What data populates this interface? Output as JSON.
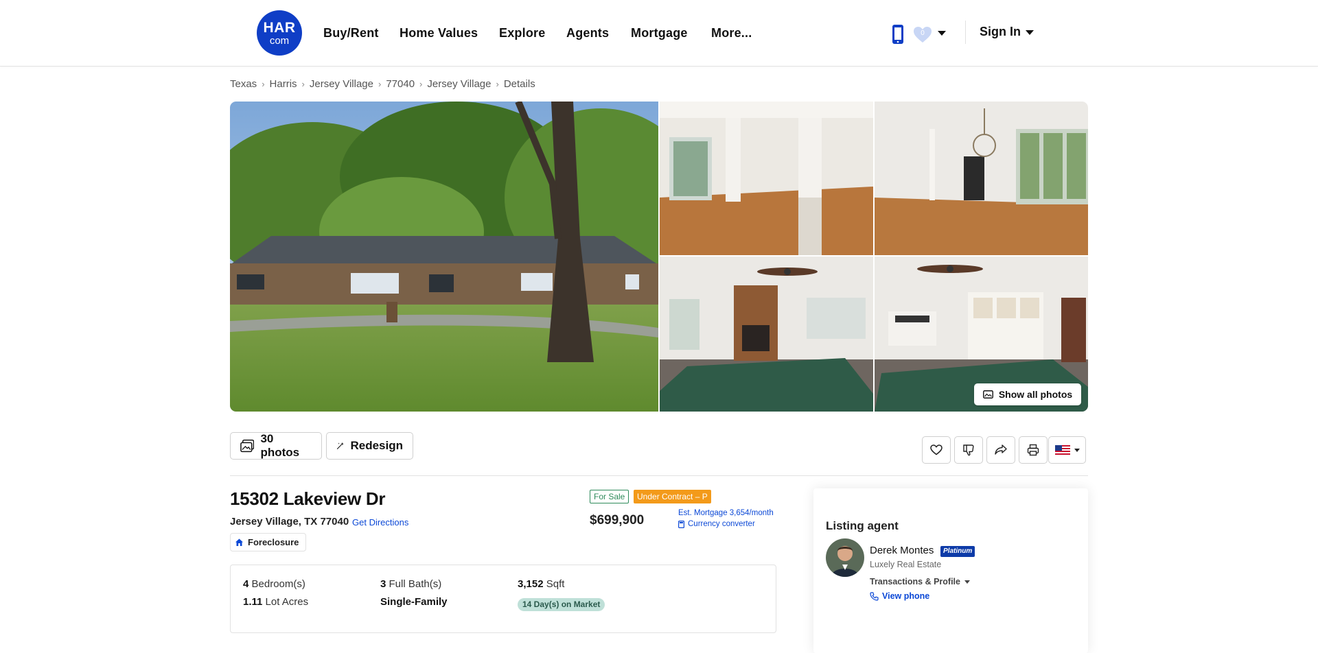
{
  "header": {
    "logo_top": "HAR",
    "logo_bottom": "com",
    "nav": [
      "Buy/Rent",
      "Home Values",
      "Explore",
      "Agents",
      "Mortgage",
      "More..."
    ],
    "favorites_count": "0",
    "sign_in": "Sign In",
    "colors": {
      "brand": "#0f3ec6"
    }
  },
  "breadcrumb": [
    "Texas",
    "Harris",
    "Jersey Village",
    "77040",
    "Jersey Village",
    "Details"
  ],
  "gallery": {
    "show_all": "Show all photos",
    "photos": [
      "front-exterior",
      "living-room-columns",
      "dining-room-chandelier",
      "family-room-fireplace",
      "family-room-kitchen"
    ]
  },
  "toolbar": {
    "photos_label": "30 photos",
    "redesign_label": "Redesign",
    "actions": [
      "heart-icon",
      "thumbs-down-icon",
      "share-icon",
      "print-icon",
      "us-flag-icon"
    ]
  },
  "listing": {
    "address": "15302 Lakeview Dr",
    "city_line": "Jersey Village, TX 77040",
    "directions": "Get Directions",
    "tag": "Foreclosure",
    "status": "For Sale",
    "contract": "Under Contract – P",
    "price": "$699,900",
    "mortgage": "Est. Mortgage 3,654/month",
    "currency": "Currency converter"
  },
  "facts": {
    "bedrooms_num": "4",
    "bedrooms_label": "Bedroom(s)",
    "baths_num": "3",
    "baths_label": "Full Bath(s)",
    "sqft_num": "3,152",
    "sqft_label": "Sqft",
    "lot_num": "1.11",
    "lot_label": "Lot Acres",
    "type": "Single-Family",
    "days_on_market": "14 Day(s) on Market"
  },
  "agent": {
    "title": "Listing agent",
    "name": "Derek Montes",
    "level": "Platinum",
    "office": "Luxely Real Estate",
    "transactions": "Transactions & Profile",
    "phone": "View phone"
  }
}
